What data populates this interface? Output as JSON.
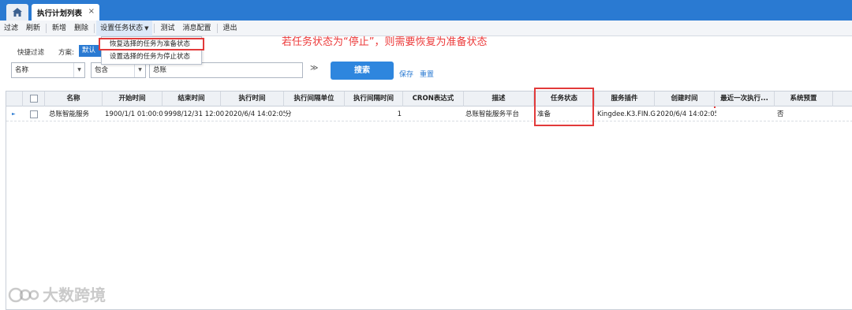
{
  "tabs": {
    "home_icon": "home-icon",
    "active": "执行计划列表",
    "close": "×"
  },
  "toolbar": {
    "items": [
      "过滤",
      "刷新",
      "新增",
      "删除",
      "设置任务状态",
      "测试",
      "消息配置",
      "退出"
    ]
  },
  "menu": {
    "items": [
      "恢复选择的任务为准备状态",
      "设置选择的任务为停止状态"
    ]
  },
  "annotation": "若任务状态为“停止”，则需要恢复为准备状态",
  "filter": {
    "quick_label": "快捷过滤",
    "scheme_label": "方案:",
    "scheme_value": "默认方案",
    "field": "名称",
    "operator": "包含",
    "value": "总账",
    "search_label": "搜索",
    "save_label": "保存",
    "reset_label": "重置"
  },
  "grid": {
    "columns": [
      "名称",
      "开始时间",
      "结束时间",
      "执行时间",
      "执行间隔单位",
      "执行间隔时间",
      "CRON表达式",
      "描述",
      "任务状态",
      "服务插件",
      "创建时间",
      "最近一次执行...",
      "系统预置"
    ],
    "rows": [
      [
        "总账智能服务",
        "1900/1/1 01:00:00",
        "9998/12/31 12:00:",
        "2020/6/4 14:02:05",
        "分",
        "1",
        "",
        "总账智能服务平台",
        "准备",
        "Kingdee.K3.FIN.G",
        "2020/6/4 14:02:05",
        "",
        "否"
      ]
    ]
  },
  "watermark": "大数跨境",
  "colors": {
    "accent": "#2a7ad2",
    "highlight": "#e23a3a",
    "annotation": "#ec3a3a"
  }
}
